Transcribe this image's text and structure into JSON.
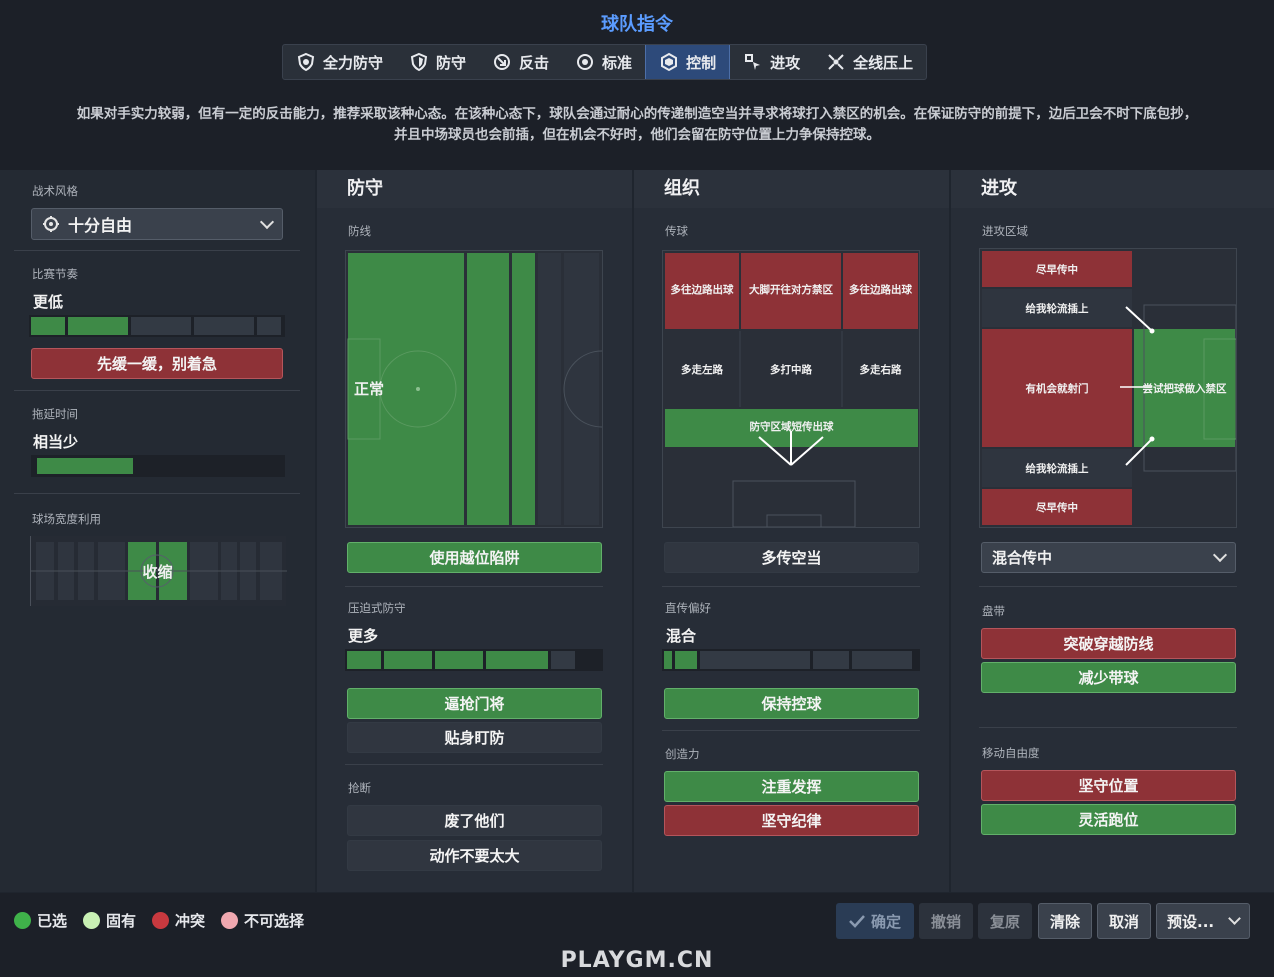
{
  "header": {
    "title": "球队指令",
    "description_line1": "如果对手实力较弱，但有一定的反击能力，推荐采取该种心态。在该种心态下，球队会通过耐心的传递制造空当并寻求将球打入禁区的机会。在保证防守的前提下，边后卫会不时下底包抄，",
    "description_line2": "并且中场球员也会前插，但在机会不好时，他们会留在防守位置上力争保持控球。"
  },
  "mentality": {
    "tabs": [
      "全力防守",
      "防守",
      "反击",
      "标准",
      "控制",
      "进攻",
      "全线压上"
    ],
    "active": "控制"
  },
  "left": {
    "style_label": "战术风格",
    "style_value": "十分自由",
    "tempo_label": "比赛节奏",
    "tempo_value": "更低",
    "tempo_level": 2,
    "tempo_button": "先缓一缓，别着急",
    "timewasting_label": "拖延时间",
    "timewasting_value": "相当少",
    "timewasting_fraction": 0.4,
    "width_label": "球场宽度利用",
    "width_value": "收缩"
  },
  "defense": {
    "title": "防守",
    "line_label": "防线",
    "line_value": "正常",
    "offside_button": "使用越位陷阱",
    "press_label": "压迫式防守",
    "press_value": "更多",
    "press_level": 4,
    "press_buttons": [
      "逼抢门将",
      "贴身盯防"
    ],
    "tackle_label": "抢断",
    "tackle_buttons": [
      "废了他们",
      "动作不要太大"
    ]
  },
  "organization": {
    "title": "组织",
    "pass_label": "传球",
    "pitch_cells": {
      "top": [
        "多往边路出球",
        "大脚开往对方禁区",
        "多往边路出球"
      ],
      "mid": [
        "多走左路",
        "多打中路",
        "多走右路"
      ],
      "bottom": "防守区域短传出球"
    },
    "space_button": "多传空当",
    "directness_label": "直传偏好",
    "directness_value": "混合",
    "directness_level": 2,
    "retain_button": "保持控球",
    "creativity_label": "创造力",
    "creativity_buttons": [
      "注重发挥",
      "坚守纪律"
    ]
  },
  "attack": {
    "title": "进攻",
    "zone_label": "进攻区域",
    "zone_cells": {
      "cross1": "尽早传中",
      "overlap1": "给我轮流插上",
      "shoot": "有机会就射门",
      "workbox": "尝试把球做入禁区",
      "overlap2": "给我轮流插上",
      "cross2": "尽早传中"
    },
    "cross_dropdown": "混合传中",
    "dribble_label": "盘带",
    "dribble_buttons": [
      "突破穿越防线",
      "减少带球"
    ],
    "freedom_label": "移动自由度",
    "freedom_buttons": [
      "坚守位置",
      "灵活跑位"
    ]
  },
  "footer": {
    "legend": [
      {
        "label": "已选",
        "color": "#3fb24a"
      },
      {
        "label": "固有",
        "color": "#c8f0b4"
      },
      {
        "label": "冲突",
        "color": "#c8393f"
      },
      {
        "label": "不可选择",
        "color": "#f0a8b0"
      }
    ],
    "buttons": {
      "confirm": "确定",
      "undo": "撤销",
      "restore": "复原",
      "clear": "清除",
      "cancel": "取消",
      "preset": "预设..."
    }
  },
  "watermark": "PLAYGM.CN"
}
